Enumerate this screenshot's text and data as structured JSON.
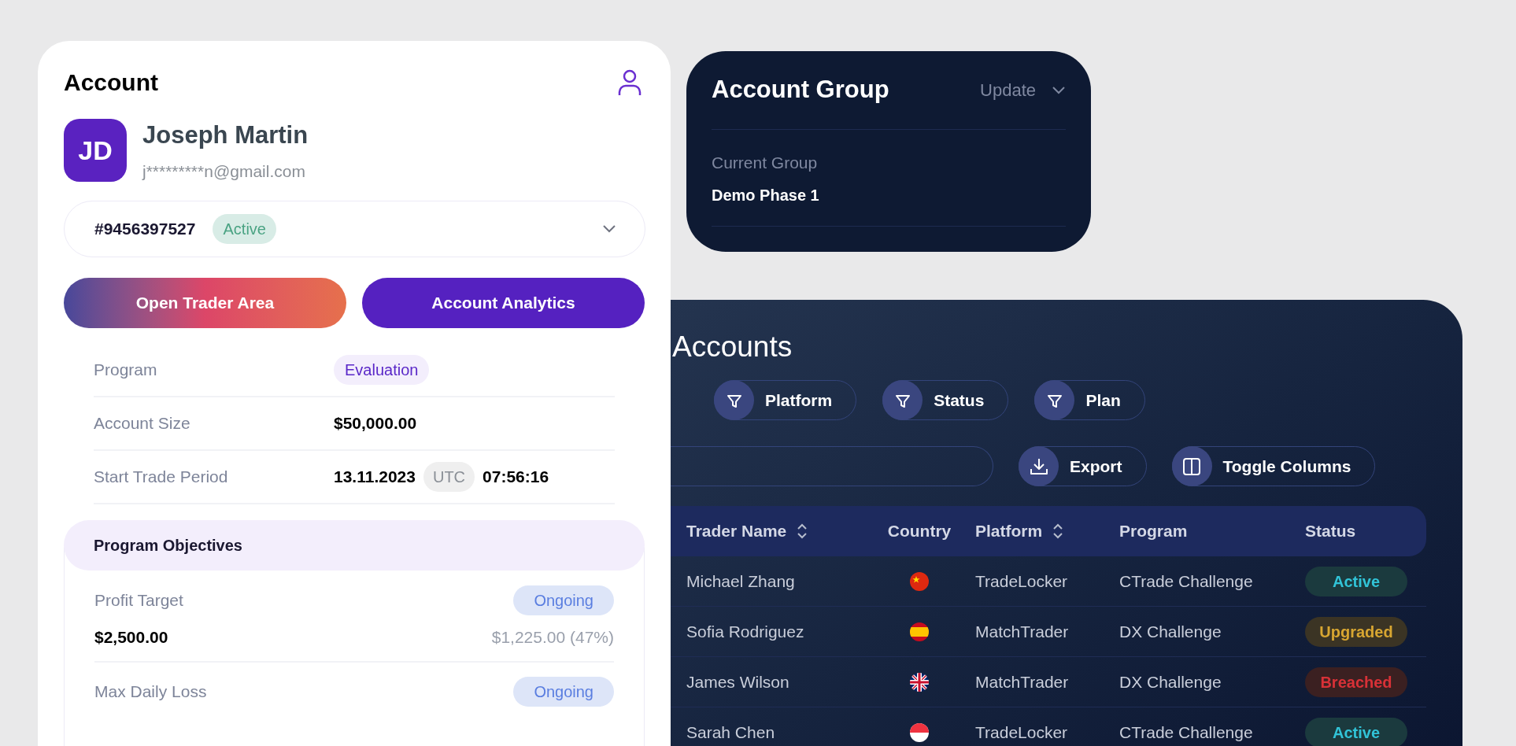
{
  "account_card": {
    "title": "Account",
    "user": {
      "initials": "JD",
      "name": "Joseph Martin",
      "email": "j*********n@gmail.com"
    },
    "account_selector": {
      "number": "#9456397527",
      "status": "Active"
    },
    "buttons": [
      {
        "label": "Open Trader Area",
        "kind": "gradient"
      },
      {
        "label": "Account Analytics",
        "kind": "solid"
      }
    ],
    "details": [
      {
        "label": "Program",
        "kind": "badge",
        "value": "Evaluation"
      },
      {
        "label": "Account Size",
        "kind": "text",
        "value": "$50,000.00"
      },
      {
        "label": "Start Trade Period",
        "kind": "datetime",
        "date": "13.11.2023",
        "zone": "UTC",
        "time": "07:56:16"
      }
    ],
    "objectives": {
      "title": "Program Objectives",
      "items": [
        {
          "label": "Profit Target",
          "status": "Ongoing",
          "target": "$2,500.00",
          "progress": "$1,225.00 (47%)"
        },
        {
          "label": "Max Daily Loss",
          "status": "Ongoing"
        }
      ]
    }
  },
  "account_group": {
    "title": "Account Group",
    "action": "Update",
    "current_label": "Current Group",
    "current_value": "Demo Phase 1"
  },
  "accounts": {
    "title": "Accounts",
    "filters": [
      "Platform",
      "Status",
      "Plan"
    ],
    "actions": [
      {
        "label": "Export",
        "kind": "export"
      },
      {
        "label": "Toggle Columns",
        "kind": "columns"
      }
    ],
    "table": {
      "columns": [
        {
          "label": "Trader Name",
          "sortable": true
        },
        {
          "label": "Country",
          "sortable": false
        },
        {
          "label": "Platform",
          "sortable": true
        },
        {
          "label": "Program",
          "sortable": false
        },
        {
          "label": "Status",
          "sortable": false
        }
      ],
      "rows": [
        {
          "trader_name": "Michael Zhang",
          "kind": "cn",
          "platform": "TradeLocker",
          "program": "CTrade Challenge",
          "status": "Active",
          "color": "#1b3a3e"
        },
        {
          "trader_name": "Sofia Rodriguez",
          "kind": "es",
          "platform": "MatchTrader",
          "program": "DX Challenge",
          "status": "Upgraded",
          "color": "#3b3424"
        },
        {
          "trader_name": "James Wilson",
          "kind": "gb",
          "platform": "MatchTrader",
          "program": "DX Challenge",
          "status": "Breached",
          "color": "#3b2021"
        },
        {
          "trader_name": "Sarah Chen",
          "kind": "sg",
          "platform": "TradeLocker",
          "program": "CTrade Challenge",
          "status": "Active",
          "color": "#1b3a3e"
        }
      ]
    }
  }
}
